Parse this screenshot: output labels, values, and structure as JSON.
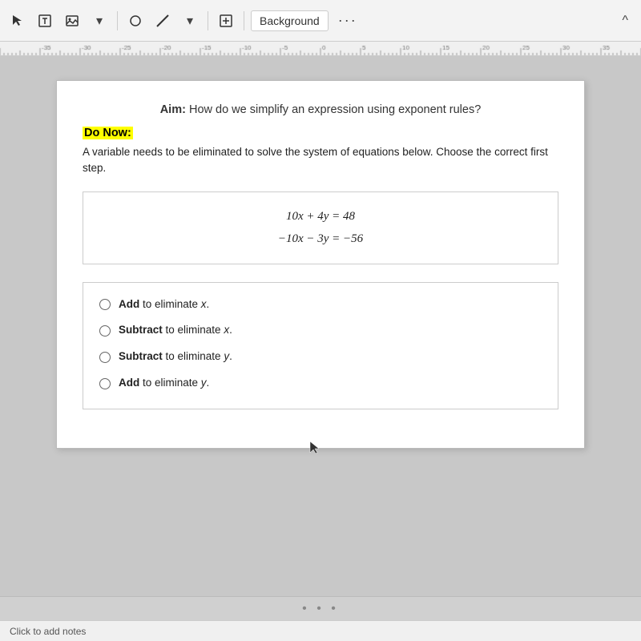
{
  "toolbar": {
    "background_label": "Background",
    "more_label": "···",
    "collapse_label": "^"
  },
  "slide": {
    "aim_prefix": "Aim:",
    "aim_text": " How do we simplify an expression using exponent rules?",
    "do_now_label": "Do Now:",
    "problem_text": "A variable needs to be eliminated to solve the system of equations below. Choose the correct first step.",
    "equation1": "10x + 4y = 48",
    "equation2": "−10x − 3y = −56",
    "choices": [
      {
        "bold": "Add",
        "rest": " to eliminate x."
      },
      {
        "bold": "Subtract",
        "rest": " to eliminate x."
      },
      {
        "bold": "Subtract",
        "rest": " to eliminate y."
      },
      {
        "bold": "Add",
        "rest": " to eliminate y."
      }
    ]
  },
  "status": {
    "text": "Click to add notes"
  }
}
